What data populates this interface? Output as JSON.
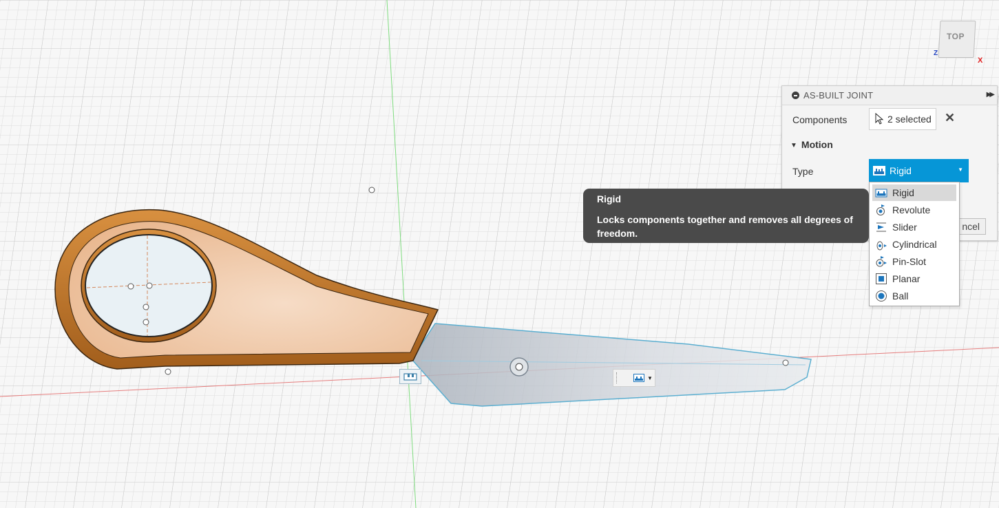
{
  "viewcube": {
    "face_label": "TOP",
    "axis_z": "Z",
    "axis_x": "X"
  },
  "panel": {
    "title": "AS-BUILT JOINT",
    "components_label": "Components",
    "components_value": "2 selected",
    "motion_label": "Motion",
    "type_label": "Type",
    "type_value": "Rigid",
    "cancel_label": "ncel"
  },
  "dropdown": {
    "items": [
      {
        "label": "Rigid",
        "icon": "rigid-icon",
        "selected": true
      },
      {
        "label": "Revolute",
        "icon": "revolute-icon"
      },
      {
        "label": "Slider",
        "icon": "slider-icon"
      },
      {
        "label": "Cylindrical",
        "icon": "cylindrical-icon"
      },
      {
        "label": "Pin-Slot",
        "icon": "pin-slot-icon"
      },
      {
        "label": "Planar",
        "icon": "planar-icon"
      },
      {
        "label": "Ball",
        "icon": "ball-icon"
      }
    ]
  },
  "tooltip": {
    "title": "Rigid",
    "body": "Locks components together and removes all degrees of freedom."
  },
  "colors": {
    "accent": "#0696d7",
    "handle_body": "#f0c9a8",
    "handle_edge": "#c47a30",
    "blade": "#c8ced6",
    "x_axis": "#e05a5a",
    "y_axis": "#6ad46a"
  }
}
